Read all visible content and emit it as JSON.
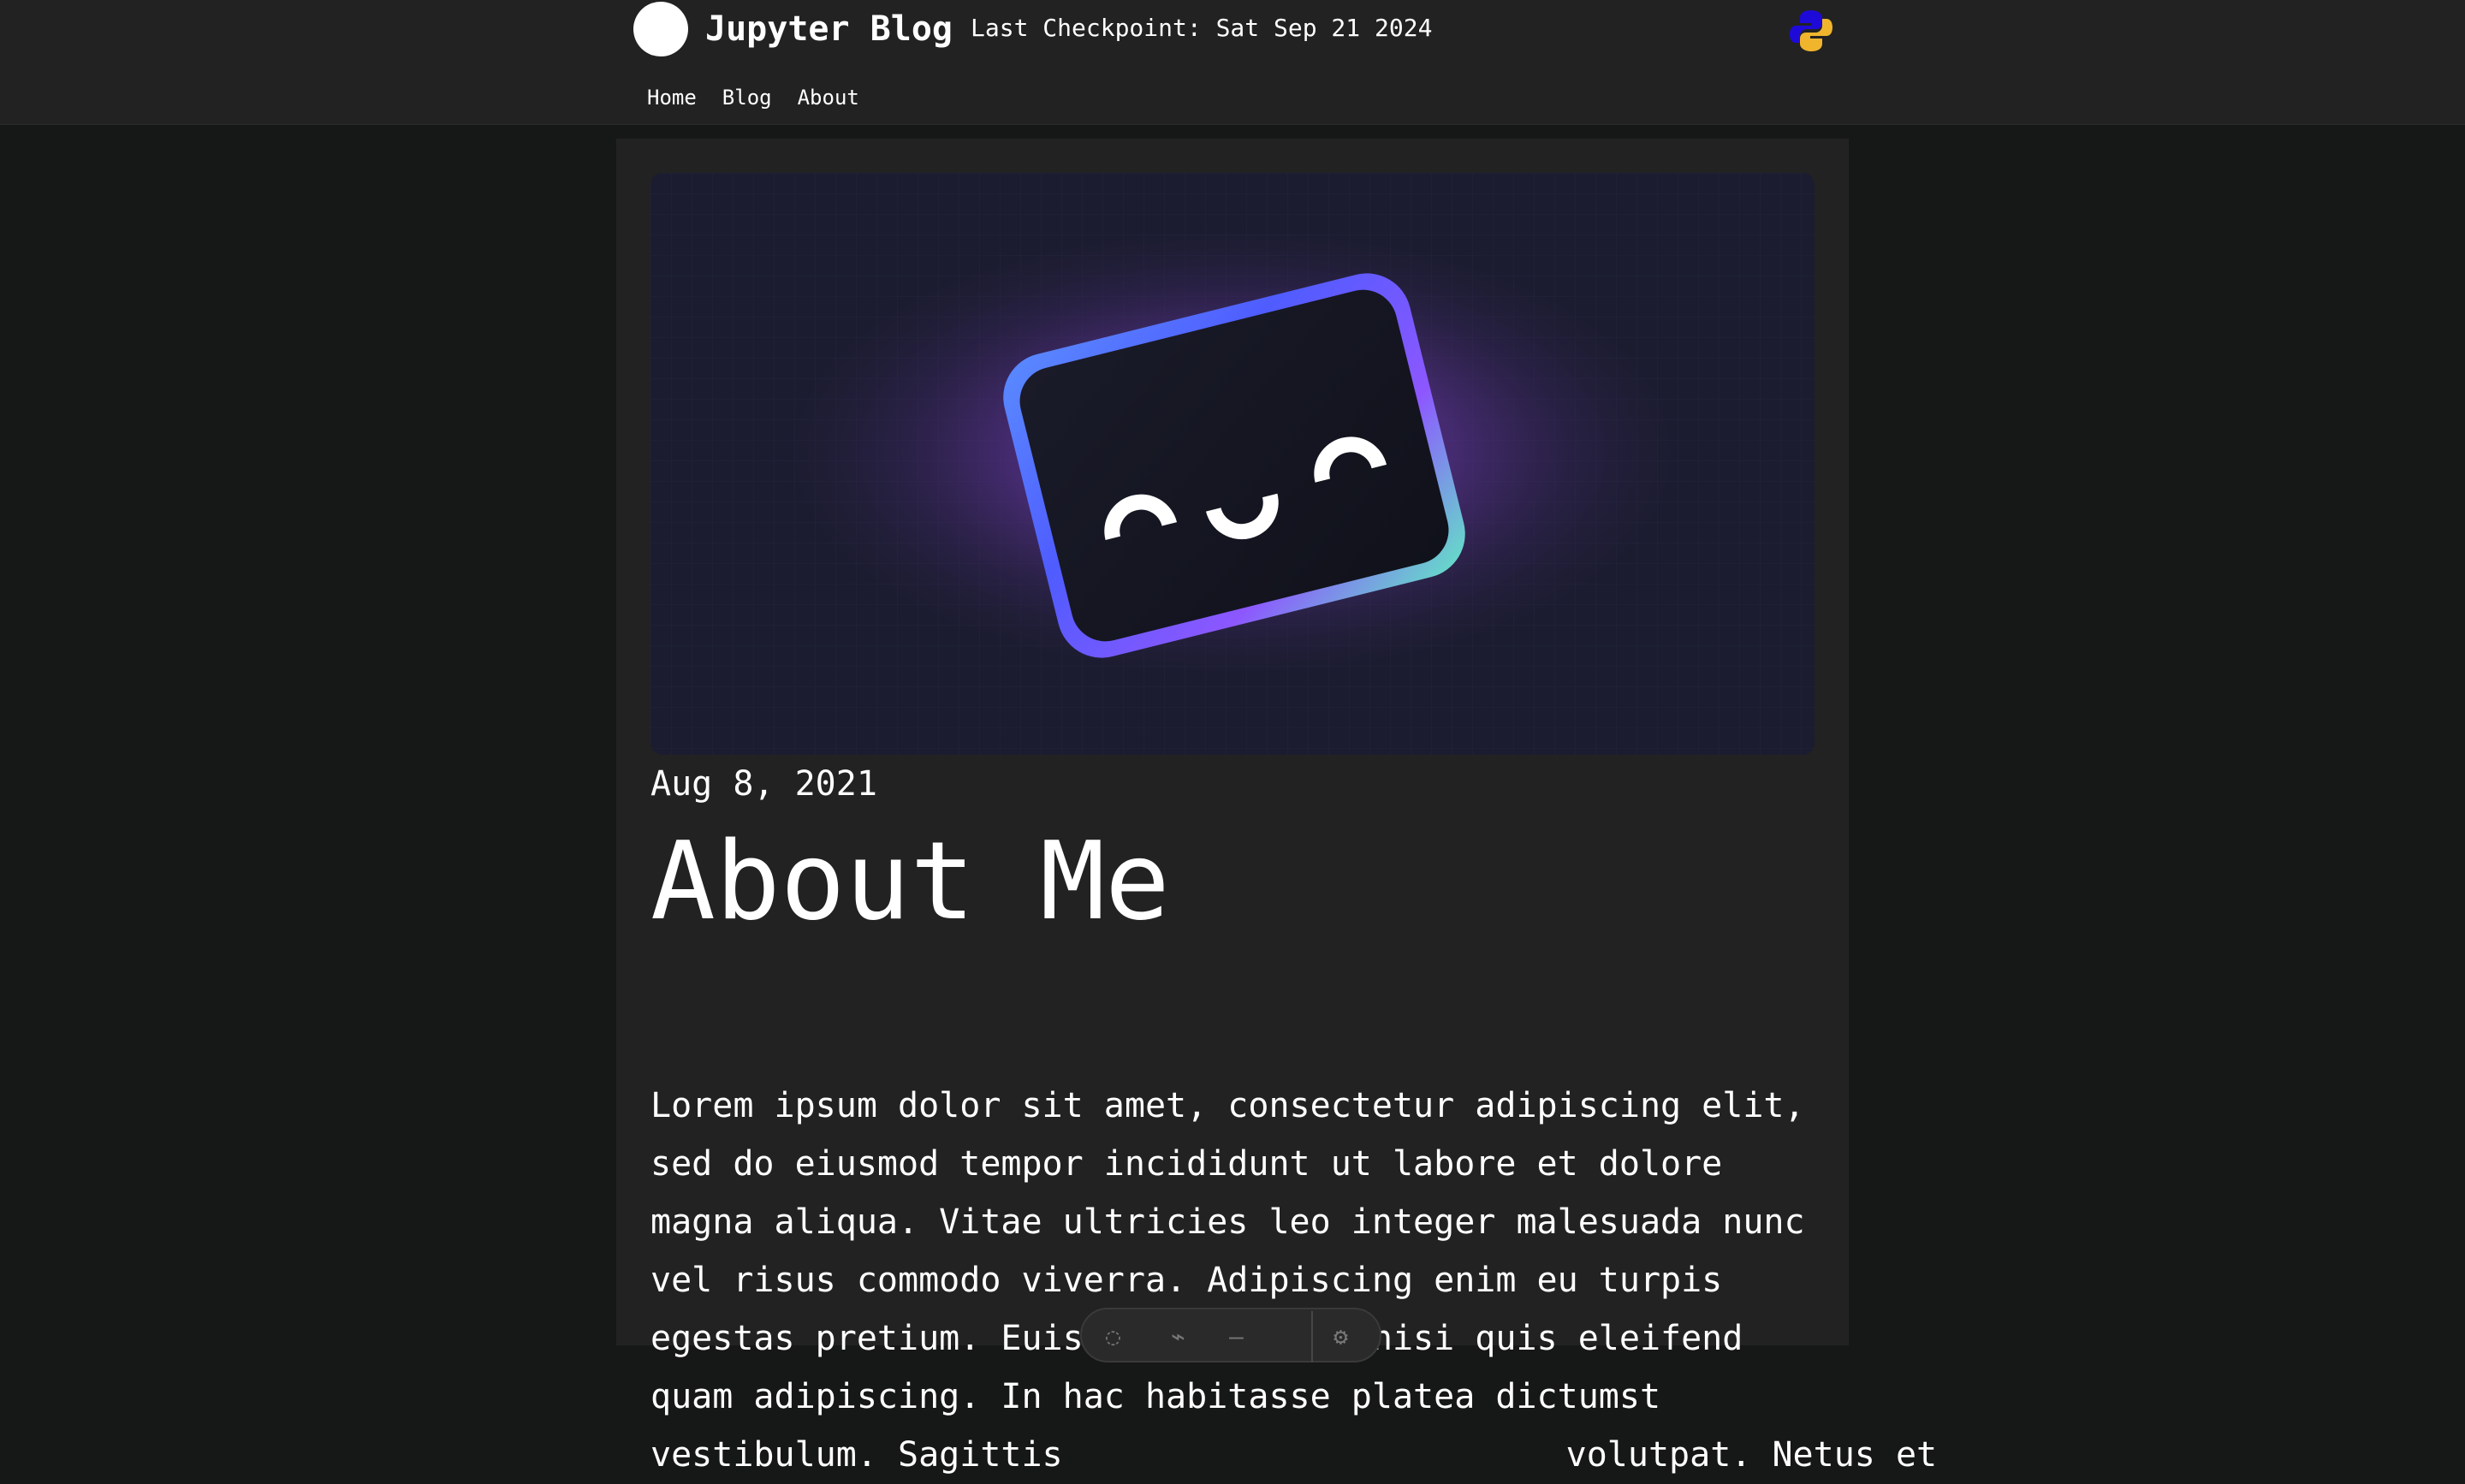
{
  "header": {
    "site_title": "Jupyter Blog",
    "checkpoint_text": "Last Checkpoint: Sat Sep 21 2024",
    "logo_icon": "circle-logo-icon",
    "python_icon": "python-icon",
    "nav": [
      {
        "label": "Home"
      },
      {
        "label": "Blog"
      },
      {
        "label": "About"
      }
    ]
  },
  "post": {
    "date": "Aug 8, 2021",
    "title": "About Me",
    "body_lines": [
      "Lorem ipsum dolor sit amet, consectetur adipiscing elit,",
      "sed do eiusmod tempor incididunt ut labore et dolore",
      "magna aliqua. Vitae ultricies leo integer malesuada nunc",
      "vel risus commodo viverra. Adipiscing enim eu turpis",
      "egestas pretium. Euismod elementum nisi quis eleifend",
      "quam adipiscing. In hac habitasse platea dictumst",
      "vestibulum. Sagittis",
      "volutpat. Netus et"
    ]
  },
  "colors": {
    "page_background": "#161817",
    "panel_background": "#222222",
    "text": "#ffffff",
    "hero_glow": "#7a3cc8",
    "hero_border_start": "#4f5cff",
    "hero_border_end": "#62e7c4"
  },
  "toolbar": {
    "icon": "floating-toolbar-icon"
  }
}
